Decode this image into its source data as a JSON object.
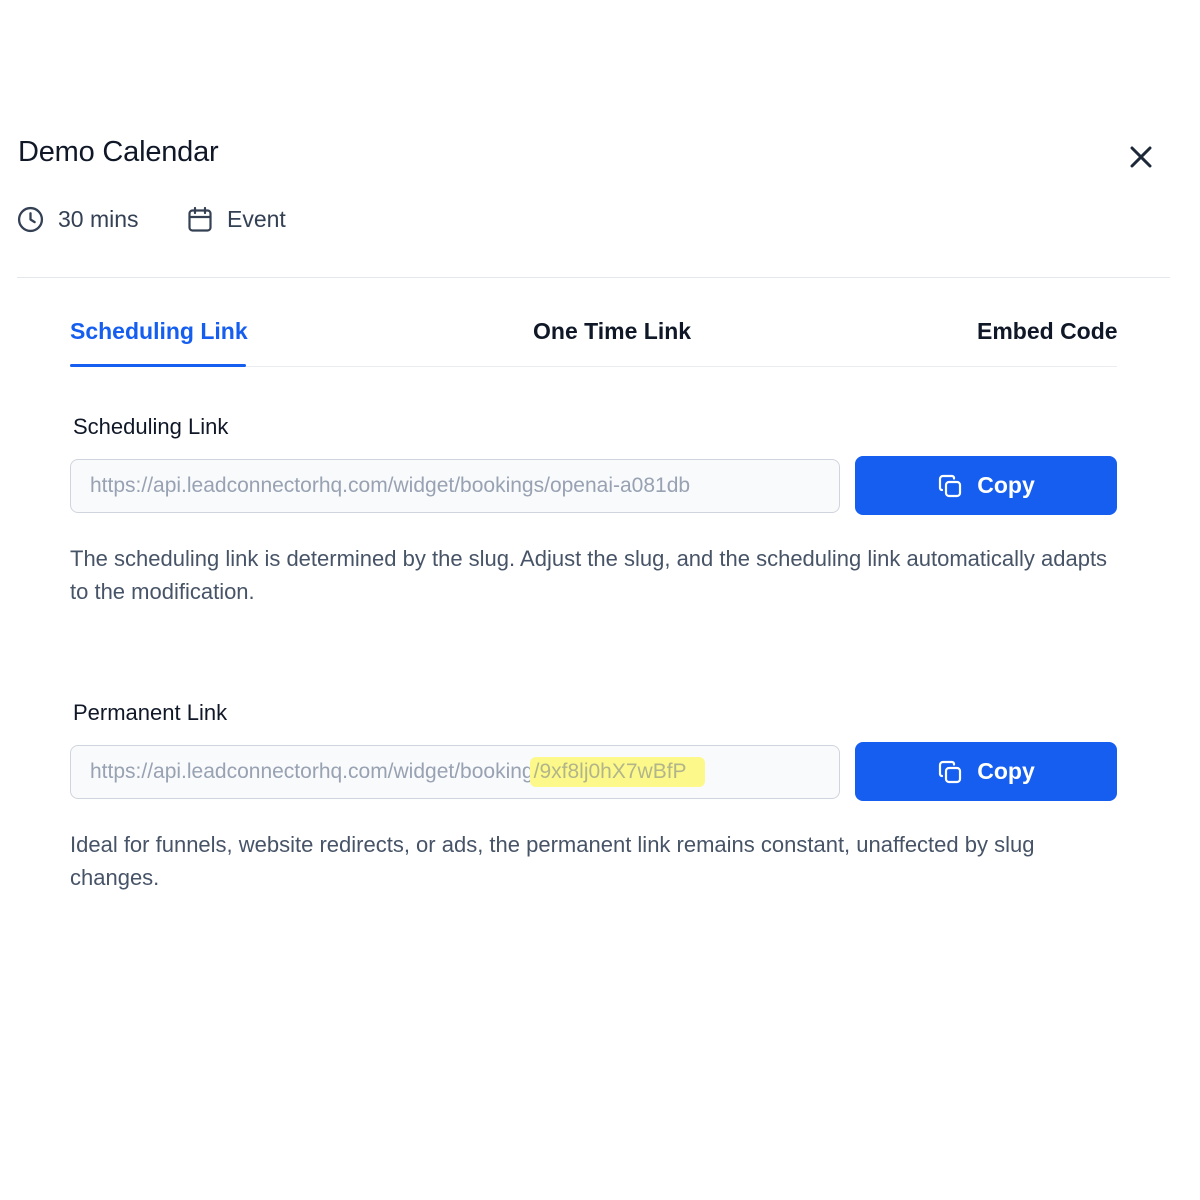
{
  "modal": {
    "title": "Demo Calendar",
    "duration": "30 mins",
    "event_type": "Event"
  },
  "icons": {
    "close": "close-icon",
    "duration": "clock-icon",
    "event_type": "calendar-icon",
    "copy": "copy-icon"
  },
  "tabs": [
    {
      "label": "Scheduling Link",
      "active": true
    },
    {
      "label": "One Time Link",
      "active": false
    },
    {
      "label": "Embed Code",
      "active": false
    }
  ],
  "scheduling": {
    "label": "Scheduling Link",
    "value": "https://api.leadconnectorhq.com/widget/bookings/openai-a081db",
    "copy_label": "Copy",
    "help": "The scheduling link is determined by the slug. Adjust the slug, and the scheduling link automatically adapts to the modification."
  },
  "permanent": {
    "label": "Permanent Link",
    "value_prefix": "https://api.leadconnectorhq.com/widget/booking",
    "value_highlighted": "/9xf8lj0hX7wBfP",
    "copy_label": "Copy",
    "help": "Ideal for funnels, website redirects, or ads, the permanent link remains constant, unaffected by slug changes."
  },
  "colors": {
    "accent": "#155eef",
    "highlight": "#fcf98a",
    "text": "#101828",
    "muted": "#475467"
  }
}
